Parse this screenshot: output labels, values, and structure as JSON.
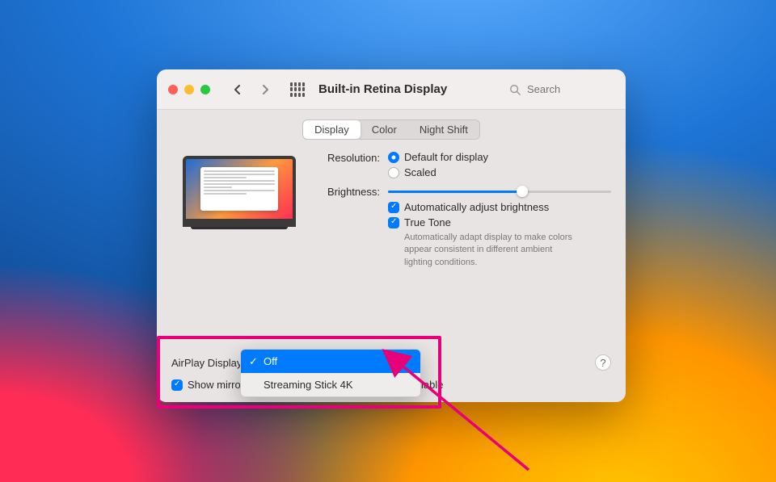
{
  "window": {
    "title": "Built-in Retina Display"
  },
  "search": {
    "placeholder": "Search"
  },
  "tabs": {
    "display": "Display",
    "color": "Color",
    "night_shift": "Night Shift"
  },
  "settings": {
    "resolution_label": "Resolution:",
    "resolution_default": "Default for display",
    "resolution_scaled": "Scaled",
    "brightness_label": "Brightness:",
    "brightness_pct": 60,
    "auto_brightness": "Automatically adjust brightness",
    "truetone": "True Tone",
    "truetone_desc": "Automatically adapt display to make colors appear consistent in different ambient lighting conditions."
  },
  "bottom": {
    "airplay_label": "AirPlay Display:",
    "show_mirror": "Show mirroring options in the menu bar when available"
  },
  "dropdown": {
    "off": "Off",
    "device": "Streaming Stick 4K"
  },
  "help": {
    "symbol": "?"
  }
}
